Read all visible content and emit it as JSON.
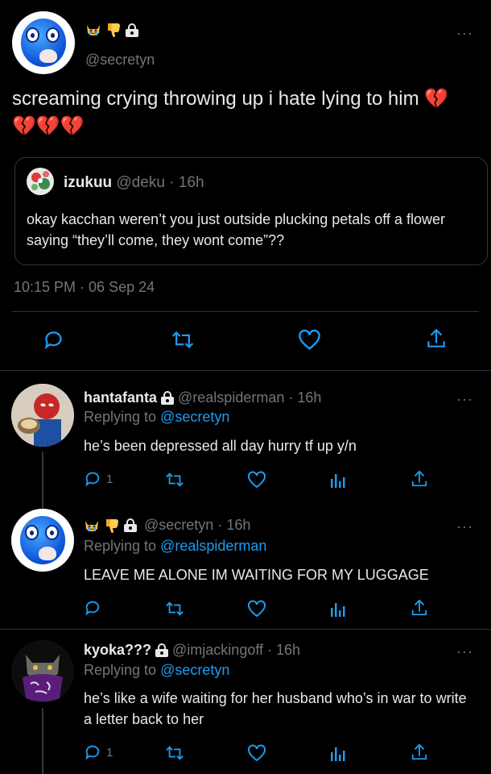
{
  "main_tweet": {
    "handle": "@secretyn",
    "text": "screaming crying throwing up i hate lying to him 💔💔💔💔",
    "timestamp": "10:15 PM · 06 Sep 24",
    "quote": {
      "name": "izukuu",
      "handle": "@deku",
      "time": "16h",
      "text": "okay kacchan weren’t you just outside plucking petals off a flower saying “they’ll come, they wont come”??"
    }
  },
  "replies": [
    {
      "name": "hantafanta",
      "handle": "@realspiderman",
      "time": "16h",
      "replying_label": "Replying to",
      "replying_to": "@secretyn",
      "text": "he’s been depressed all day hurry tf up y/n",
      "reply_count": "1"
    },
    {
      "name": "",
      "handle": "@secretyn",
      "time": "16h",
      "replying_label": "Replying to",
      "replying_to": "@realspiderman",
      "text": "LEAVE ME ALONE IM WAITING FOR MY LUGGAGE",
      "reply_count": ""
    },
    {
      "name": "kyoka???",
      "handle": "@imjackingoff",
      "time": "16h",
      "replying_label": "Replying to",
      "replying_to": "@secretyn",
      "text": "he’s like a wife waiting for her husband who’s in war to write a letter back to her",
      "reply_count": "1"
    }
  ],
  "dot_sep": "·",
  "more_glyph": "···",
  "colors": {
    "background": "#000000",
    "text": "#e7e9ea",
    "muted": "#71767b",
    "link": "#1d9bf0",
    "divider": "#2f3336"
  }
}
